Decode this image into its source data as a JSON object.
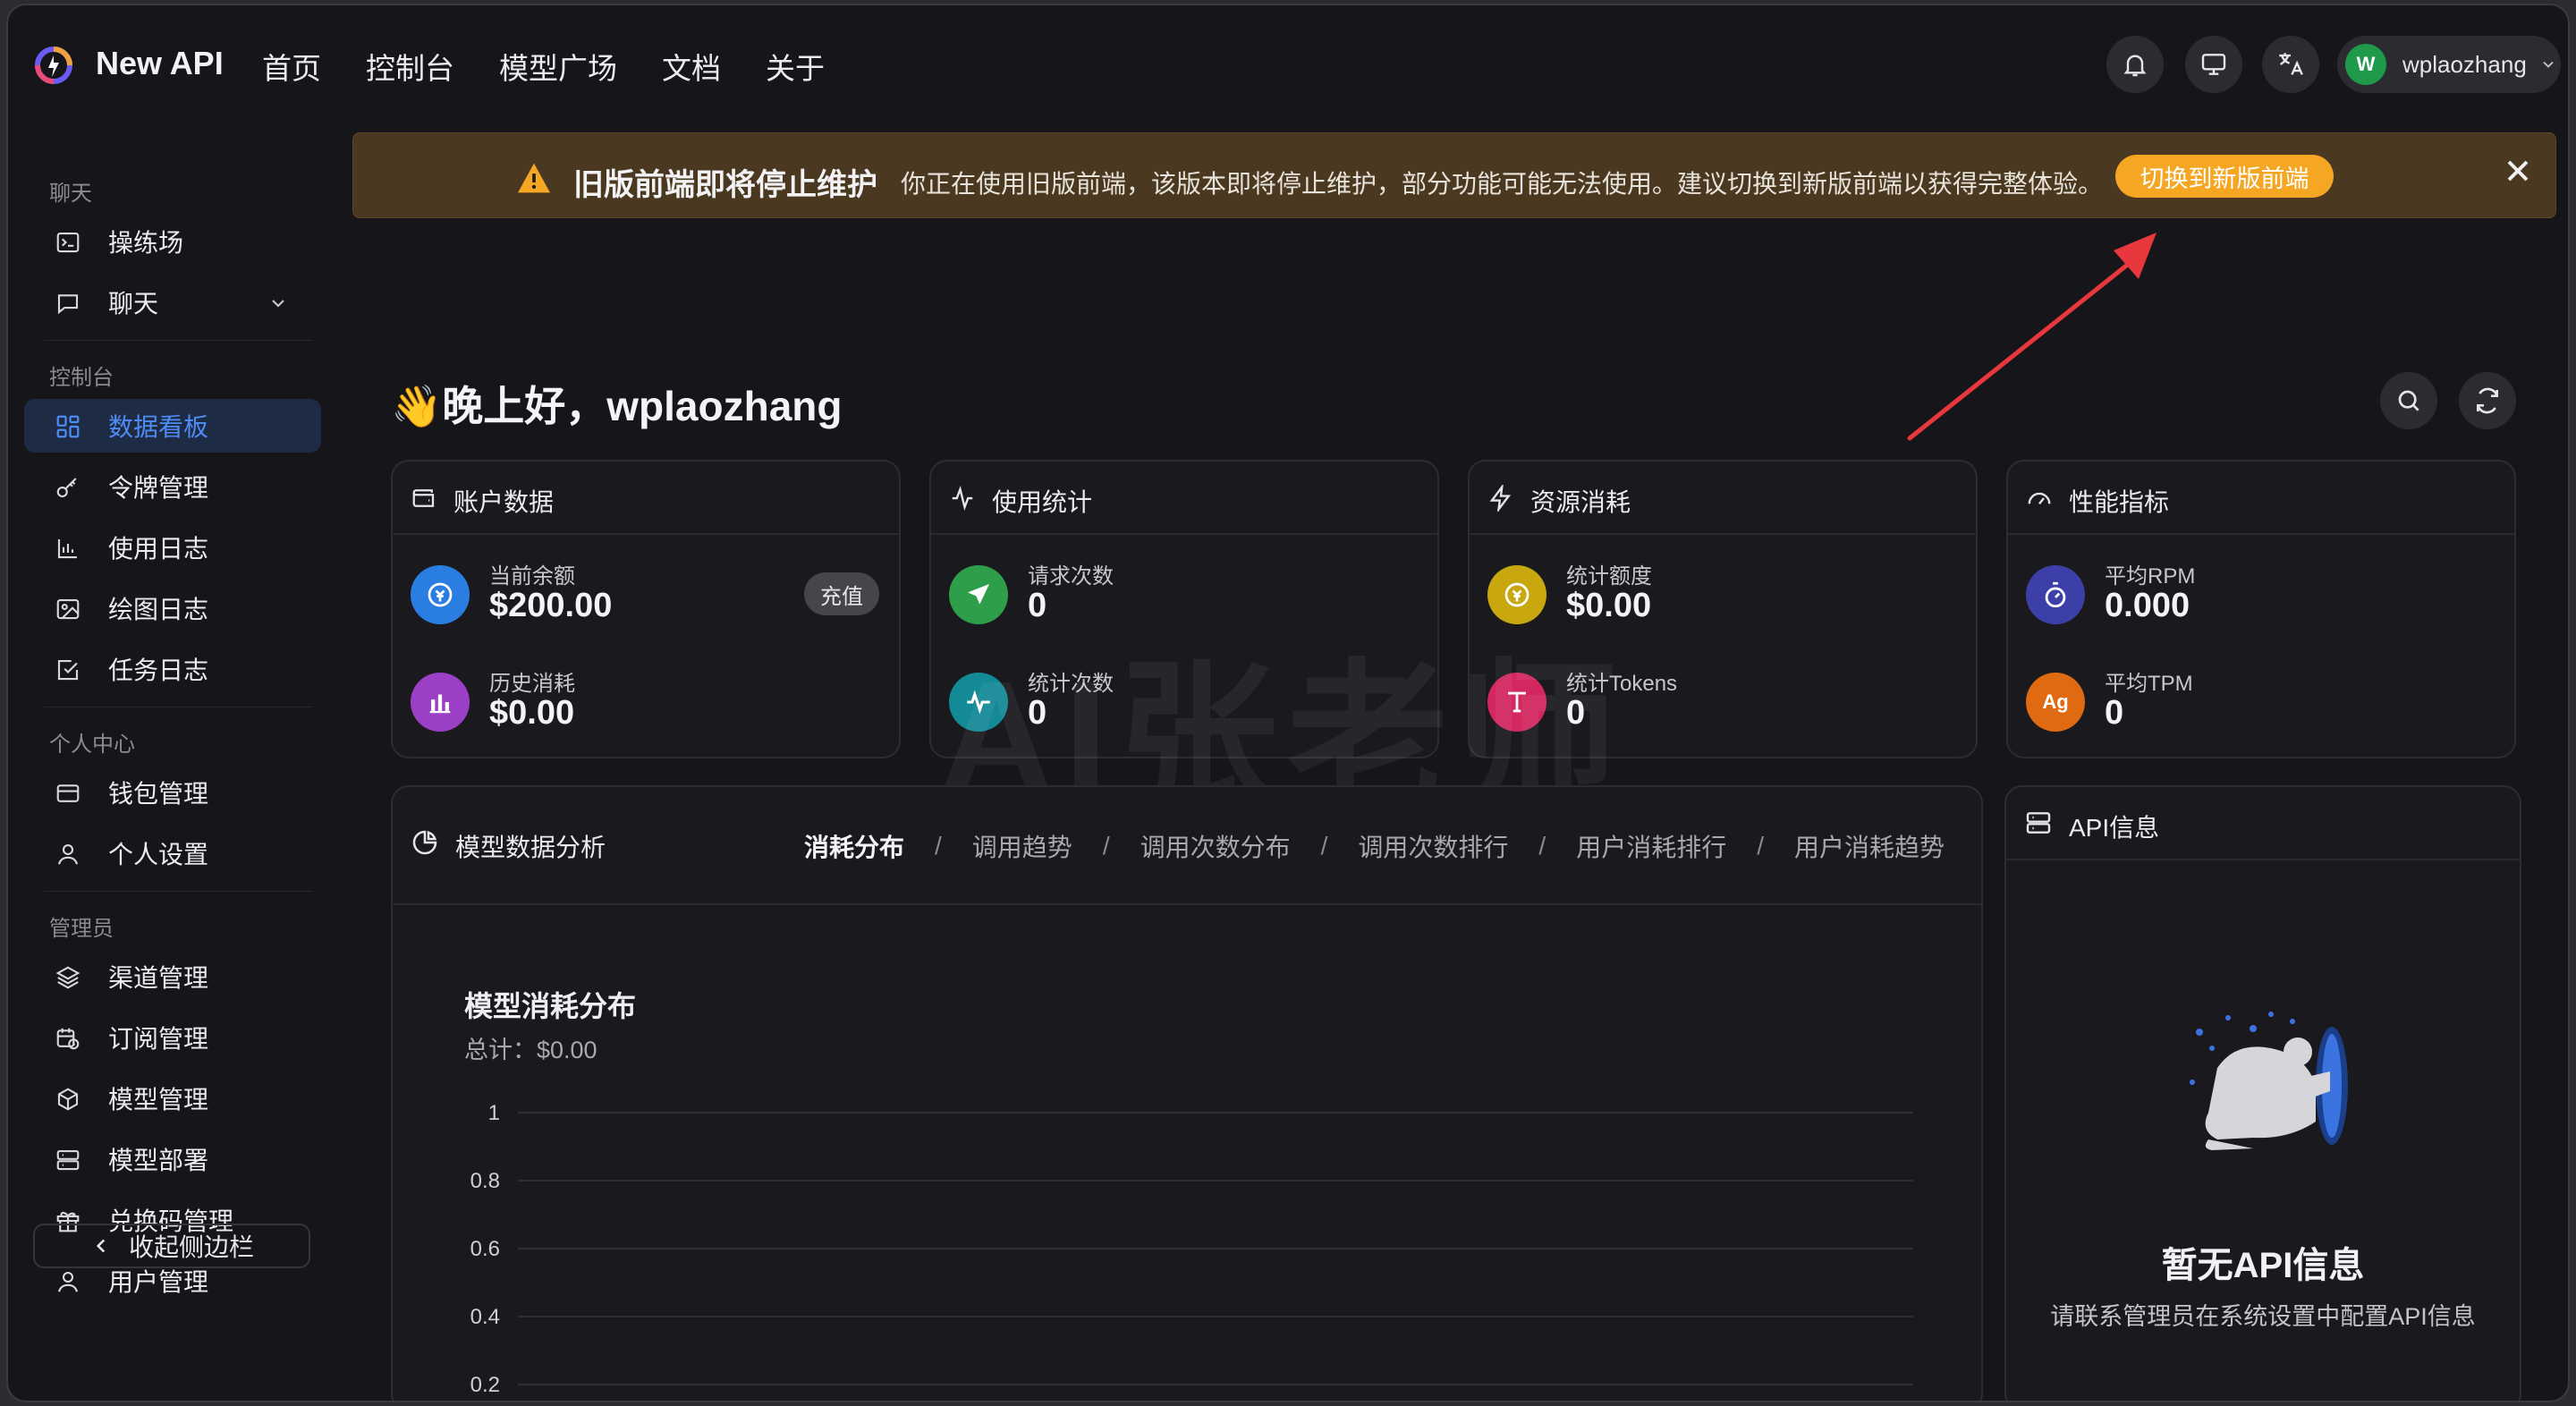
{
  "app": {
    "brand": "New API"
  },
  "nav": [
    "首页",
    "控制台",
    "模型广场",
    "文档",
    "关于"
  ],
  "user": {
    "avatar_letter": "W",
    "name": "wplaozhang"
  },
  "sidebar": {
    "groups": {
      "chat": "聊天",
      "console": "控制台",
      "personal": "个人中心",
      "admin": "管理员"
    },
    "items": {
      "playground": "操练场",
      "chat": "聊天",
      "dashboard": "数据看板",
      "tokens": "令牌管理",
      "usage_log": "使用日志",
      "draw_log": "绘图日志",
      "task_log": "任务日志",
      "wallet": "钱包管理",
      "profile": "个人设置",
      "channels": "渠道管理",
      "subscriptions": "订阅管理",
      "models": "模型管理",
      "deploy": "模型部署",
      "redeem": "兑换码管理",
      "users": "用户管理"
    },
    "collapse": "收起侧边栏"
  },
  "banner": {
    "title": "旧版前端即将停止维护",
    "text": "你正在使用旧版前端，该版本即将停止维护，部分功能可能无法使用。建议切换到新版前端以获得完整体验。",
    "button": "切换到新版前端"
  },
  "greeting": "👋晚上好，wplaozhang",
  "cards": {
    "account": {
      "title": "账户数据",
      "balance_label": "当前余额",
      "balance": "$200.00",
      "recharge": "充值",
      "spent_label": "历史消耗",
      "spent": "$0.00"
    },
    "usage": {
      "title": "使用统计",
      "req_label": "请求次数",
      "req": "0",
      "count_label": "统计次数",
      "count": "0"
    },
    "resource": {
      "title": "资源消耗",
      "quota_label": "统计额度",
      "quota": "$0.00",
      "tokens_label": "统计Tokens",
      "tokens": "0"
    },
    "perf": {
      "title": "性能指标",
      "rpm_label": "平均RPM",
      "rpm": "0.000",
      "tpm_label": "平均TPM",
      "tpm": "0",
      "tpm_badge": "Ag"
    }
  },
  "analysis": {
    "title": "模型数据分析",
    "tabs": [
      "消耗分布",
      "调用趋势",
      "调用次数分布",
      "调用次数排行",
      "用户消耗排行",
      "用户消耗趋势"
    ],
    "chart_title": "模型消耗分布",
    "chart_total": "总计：$0.00"
  },
  "chart_data": {
    "type": "bar",
    "title": "模型消耗分布",
    "categories": [],
    "values": [],
    "y_ticks": [
      "1",
      "0.8",
      "0.6",
      "0.4",
      "0.2"
    ],
    "ylim": [
      0,
      1
    ],
    "grid": true
  },
  "api": {
    "title": "API信息",
    "empty": "暂无API信息",
    "desc": "请联系管理员在系统设置中配置API信息"
  },
  "watermark": "AI张老师",
  "colors": {
    "accent": "#4f8bf5",
    "banner_btn": "#f5a623",
    "annotation_arrow": "#e8383d"
  }
}
